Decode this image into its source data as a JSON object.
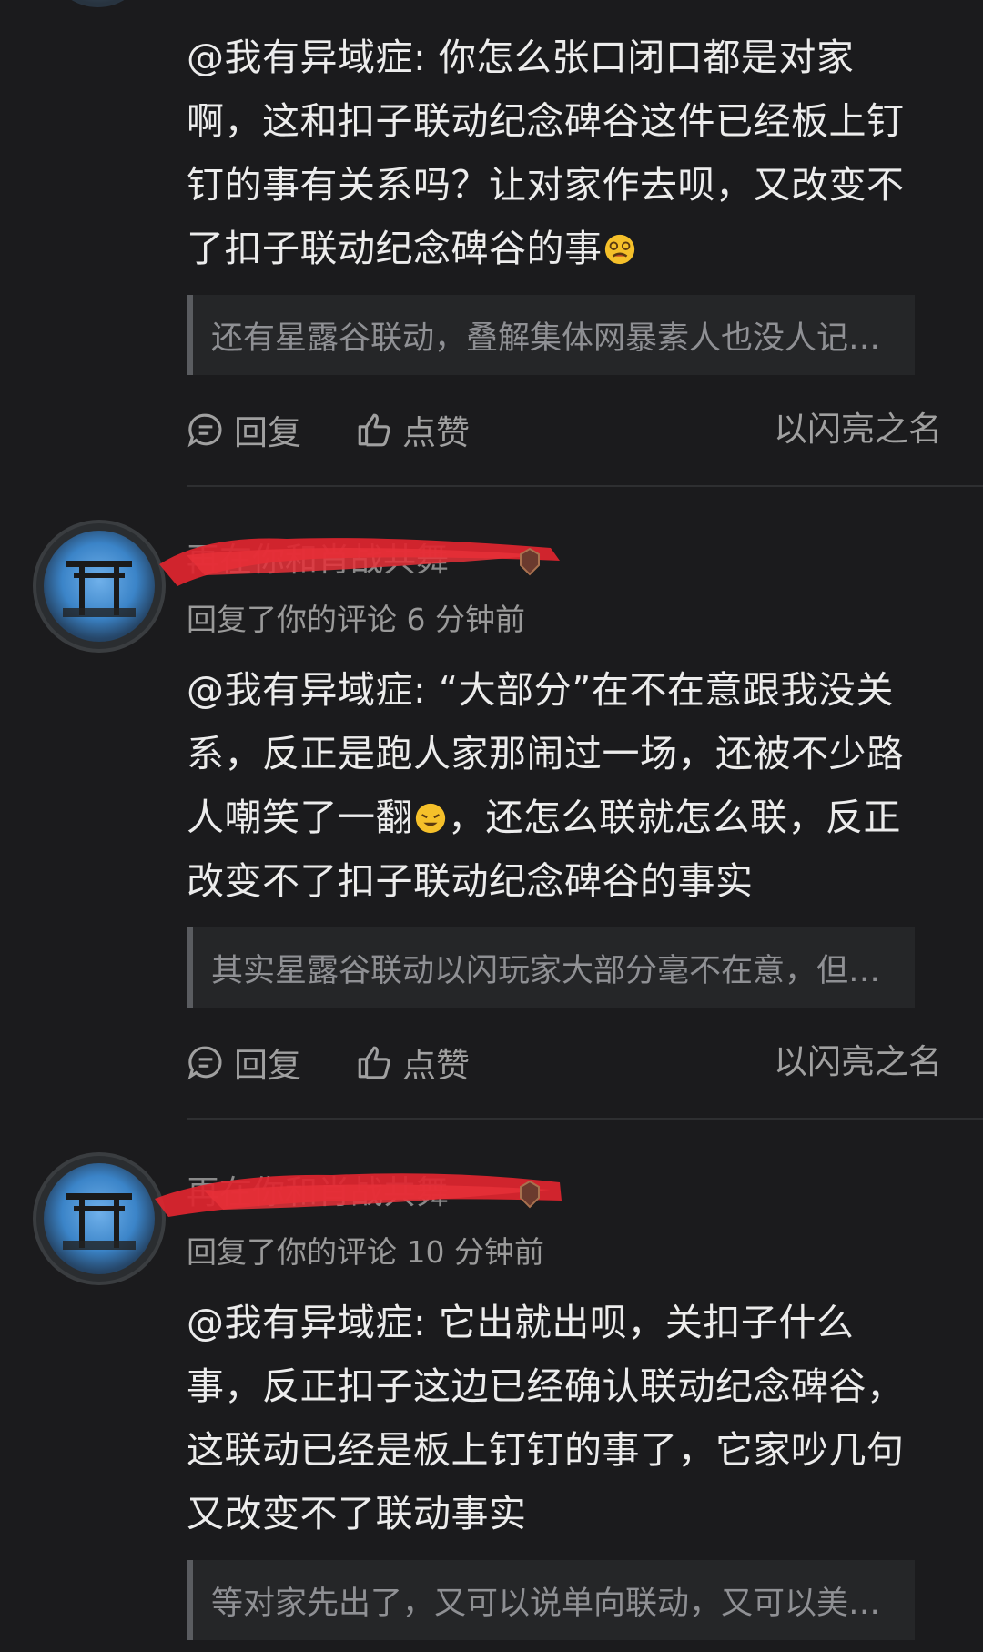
{
  "comments": [
    {
      "mention": "@我有异域症: ",
      "body": "你怎么张口闭口都是对家啊，这和扣子联动纪念碑谷这件已经板上钉钉的事有关系吗？让对家作去呗，又改变不了扣子联动纪念碑谷的事",
      "emoji": "dizzy-face",
      "quote": "还有星露谷联动，叠解集体网暴素人也没人记…",
      "reply_label": "回复",
      "like_label": "点赞",
      "source": "以闪亮之名"
    },
    {
      "username": "再在你和肖战共舞",
      "meta": "回复了你的评论 6 分钟前",
      "mention": "@我有异域症: ",
      "body_1": "“大部分”在不在意跟我没关系，反正是跑人家那闹过一场，还被不少路人嘲笑了一翻",
      "emoji": "laughing-face",
      "body_2": "，还怎么联就怎么联，反正改变不了扣子联动纪念碑谷的事实",
      "quote": "其实星露谷联动以闪玩家大部分毫不在意，但…",
      "reply_label": "回复",
      "like_label": "点赞",
      "source": "以闪亮之名"
    },
    {
      "username": "再在你和肖战共舞",
      "meta": "回复了你的评论 10 分钟前",
      "mention": "@我有异域症: ",
      "body": "它出就出呗，关扣子什么事，反正扣子这边已经确认联动纪念碑谷，这联动已经是板上钉钉的事了，它家吵几句又改变不了联动事实",
      "quote": "等对家先出了，又可以说单向联动，又可以美…"
    }
  ],
  "colors": {
    "background": "#1b1b1d",
    "redaction": "#e0252f",
    "quote_bg": "#252628"
  }
}
